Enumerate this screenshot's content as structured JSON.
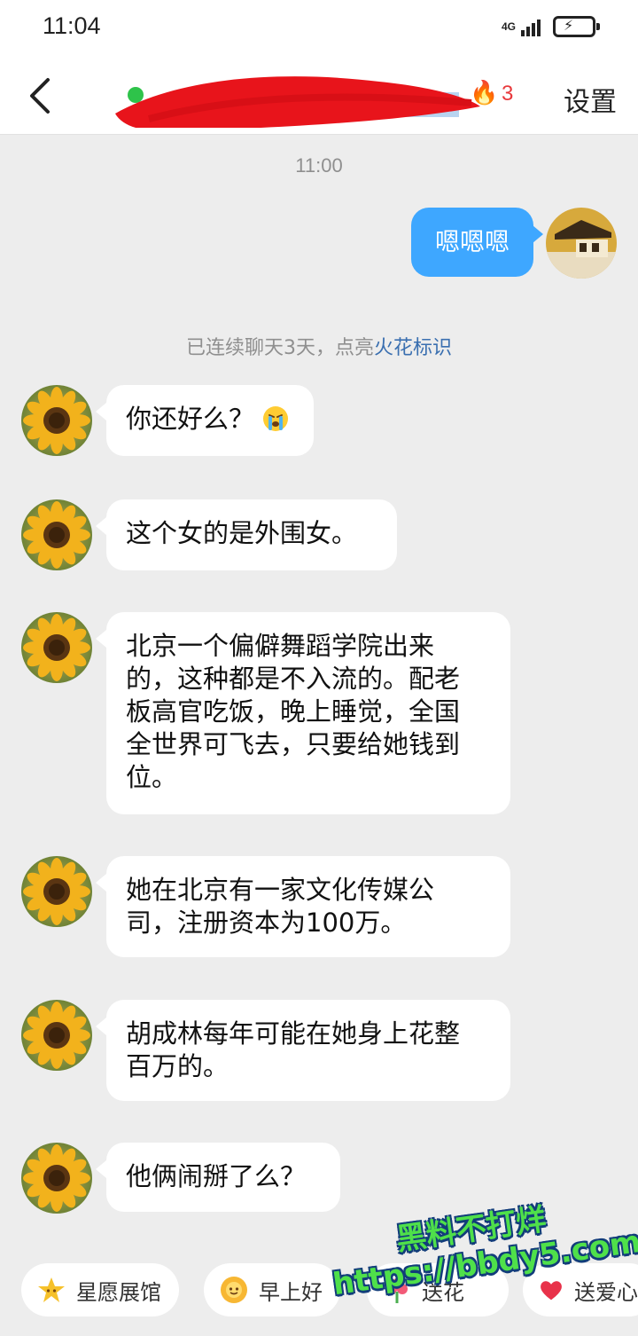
{
  "status_bar": {
    "time": "11:04",
    "network": "4G"
  },
  "header": {
    "fire_count": "3",
    "settings_label": "设置"
  },
  "chat": {
    "timestamp": "11:00",
    "outgoing_message": "嗯嗯嗯",
    "streak_notice": {
      "prefix": "已连续聊天3天，点亮",
      "link": "火花标识"
    },
    "incoming_messages": [
      {
        "text": "你还好么？"
      },
      {
        "text": "这个女的是外围女。"
      },
      {
        "lines": [
          "北京一个偏僻舞蹈学院出来",
          "的，这种都是不入流的。配老",
          "板高官吃饭，晚上睡觉，全国",
          "全世界可飞去，只要给她钱到",
          "位。"
        ]
      },
      {
        "lines": [
          "她在北京有一家文化传媒公",
          "司，注册资本为100万。"
        ]
      },
      {
        "lines": [
          "胡成林每年可能在她身上花整",
          "百万的。"
        ]
      },
      {
        "text": "他俩闹掰了么？"
      }
    ]
  },
  "quick_chips": [
    {
      "label": "星愿展馆",
      "icon": "star-icon"
    },
    {
      "label": "早上好",
      "icon": "sun-face-icon"
    },
    {
      "label": "送花",
      "icon": "flower-icon"
    },
    {
      "label": "送爱心",
      "icon": "heart-icon"
    }
  ],
  "watermark": {
    "line1": "黑料不打烊",
    "line2": "https://bbdy5.com"
  },
  "colors": {
    "outgoing_bubble": "#3ea7ff",
    "online": "#2ec34a",
    "fire": "#e8393c",
    "link": "#3a6fb0",
    "watermark": "#4fe04a"
  }
}
